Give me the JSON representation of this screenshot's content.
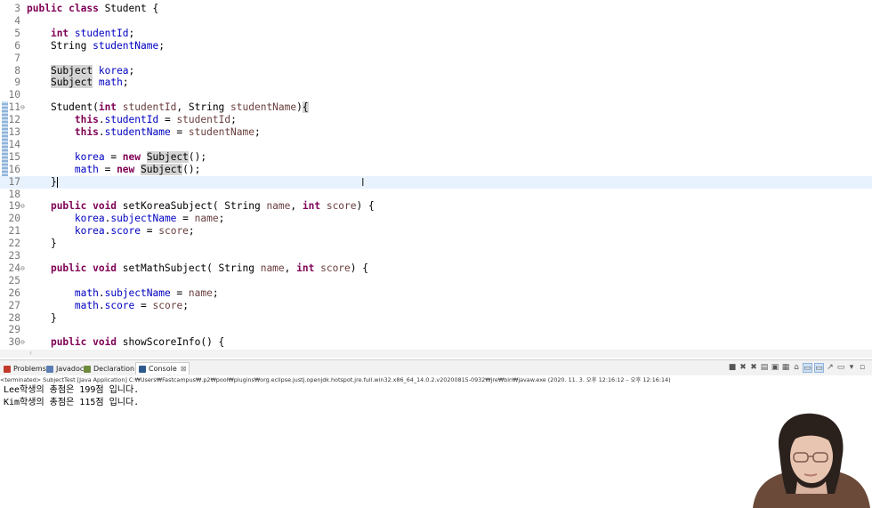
{
  "editor": {
    "lines": [
      {
        "n": "3",
        "segs": [
          {
            "t": "public class ",
            "c": "kw"
          },
          {
            "t": "Student {"
          }
        ]
      },
      {
        "n": "4",
        "segs": []
      },
      {
        "n": "5",
        "segs": [
          {
            "t": "    "
          },
          {
            "t": "int ",
            "c": "kw"
          },
          {
            "t": "studentId",
            "c": "fd"
          },
          {
            "t": ";"
          }
        ]
      },
      {
        "n": "6",
        "segs": [
          {
            "t": "    String "
          },
          {
            "t": "studentName",
            "c": "fd"
          },
          {
            "t": ";"
          }
        ]
      },
      {
        "n": "7",
        "segs": []
      },
      {
        "n": "8",
        "segs": [
          {
            "t": "    "
          },
          {
            "t": "Subject",
            "c": "hl"
          },
          {
            "t": " "
          },
          {
            "t": "korea",
            "c": "fd"
          },
          {
            "t": ";"
          }
        ]
      },
      {
        "n": "9",
        "segs": [
          {
            "t": "    "
          },
          {
            "t": "Subject",
            "c": "hl"
          },
          {
            "t": " "
          },
          {
            "t": "math",
            "c": "fd"
          },
          {
            "t": ";"
          }
        ]
      },
      {
        "n": "10",
        "segs": []
      },
      {
        "n": "11",
        "fold": true,
        "segs": [
          {
            "t": "    Student("
          },
          {
            "t": "int ",
            "c": "kw"
          },
          {
            "t": "studentId",
            "c": "pm"
          },
          {
            "t": ", String "
          },
          {
            "t": "studentName",
            "c": "pm"
          },
          {
            "t": ")"
          },
          {
            "t": "{",
            "c": "hl"
          }
        ]
      },
      {
        "n": "12",
        "segs": [
          {
            "t": "        "
          },
          {
            "t": "this",
            "c": "kw"
          },
          {
            "t": "."
          },
          {
            "t": "studentId",
            "c": "fd"
          },
          {
            "t": " = "
          },
          {
            "t": "studentId",
            "c": "pm"
          },
          {
            "t": ";"
          }
        ]
      },
      {
        "n": "13",
        "segs": [
          {
            "t": "        "
          },
          {
            "t": "this",
            "c": "kw"
          },
          {
            "t": "."
          },
          {
            "t": "studentName",
            "c": "fd"
          },
          {
            "t": " = "
          },
          {
            "t": "studentName",
            "c": "pm"
          },
          {
            "t": ";"
          }
        ]
      },
      {
        "n": "14",
        "segs": []
      },
      {
        "n": "15",
        "segs": [
          {
            "t": "        "
          },
          {
            "t": "korea",
            "c": "fd"
          },
          {
            "t": " = "
          },
          {
            "t": "new ",
            "c": "kw"
          },
          {
            "t": "Subject",
            "c": "hl"
          },
          {
            "t": "();"
          }
        ]
      },
      {
        "n": "16",
        "segs": [
          {
            "t": "        "
          },
          {
            "t": "math",
            "c": "fd"
          },
          {
            "t": " = "
          },
          {
            "t": "new ",
            "c": "kw"
          },
          {
            "t": "Subject",
            "c": "hl"
          },
          {
            "t": "();"
          }
        ]
      },
      {
        "n": "17",
        "current": true,
        "segs": [
          {
            "t": "    }"
          },
          {
            "caret": true
          }
        ]
      },
      {
        "n": "18",
        "segs": []
      },
      {
        "n": "19",
        "fold": true,
        "segs": [
          {
            "t": "    "
          },
          {
            "t": "public void ",
            "c": "kw"
          },
          {
            "t": "setKoreaSubject( String "
          },
          {
            "t": "name",
            "c": "pm"
          },
          {
            "t": ", "
          },
          {
            "t": "int ",
            "c": "kw"
          },
          {
            "t": "score",
            "c": "pm"
          },
          {
            "t": ") {"
          }
        ]
      },
      {
        "n": "20",
        "segs": [
          {
            "t": "        "
          },
          {
            "t": "korea",
            "c": "fd"
          },
          {
            "t": "."
          },
          {
            "t": "subjectName",
            "c": "fd"
          },
          {
            "t": " = "
          },
          {
            "t": "name",
            "c": "pm"
          },
          {
            "t": ";"
          }
        ]
      },
      {
        "n": "21",
        "segs": [
          {
            "t": "        "
          },
          {
            "t": "korea",
            "c": "fd"
          },
          {
            "t": "."
          },
          {
            "t": "score",
            "c": "fd"
          },
          {
            "t": " = "
          },
          {
            "t": "score",
            "c": "pm"
          },
          {
            "t": ";"
          }
        ]
      },
      {
        "n": "22",
        "segs": [
          {
            "t": "    }"
          }
        ]
      },
      {
        "n": "23",
        "segs": []
      },
      {
        "n": "24",
        "fold": true,
        "segs": [
          {
            "t": "    "
          },
          {
            "t": "public void ",
            "c": "kw"
          },
          {
            "t": "setMathSubject( String "
          },
          {
            "t": "name",
            "c": "pm"
          },
          {
            "t": ", "
          },
          {
            "t": "int ",
            "c": "kw"
          },
          {
            "t": "score",
            "c": "pm"
          },
          {
            "t": ") {"
          }
        ]
      },
      {
        "n": "25",
        "segs": []
      },
      {
        "n": "26",
        "segs": [
          {
            "t": "        "
          },
          {
            "t": "math",
            "c": "fd"
          },
          {
            "t": "."
          },
          {
            "t": "subjectName",
            "c": "fd"
          },
          {
            "t": " = "
          },
          {
            "t": "name",
            "c": "pm"
          },
          {
            "t": ";"
          }
        ]
      },
      {
        "n": "27",
        "segs": [
          {
            "t": "        "
          },
          {
            "t": "math",
            "c": "fd"
          },
          {
            "t": "."
          },
          {
            "t": "score",
            "c": "fd"
          },
          {
            "t": " = "
          },
          {
            "t": "score",
            "c": "pm"
          },
          {
            "t": ";"
          }
        ]
      },
      {
        "n": "28",
        "segs": [
          {
            "t": "    }"
          }
        ]
      },
      {
        "n": "29",
        "segs": []
      },
      {
        "n": "30",
        "fold": true,
        "segs": [
          {
            "t": "    "
          },
          {
            "t": "public void ",
            "c": "kw"
          },
          {
            "t": "showScoreInfo() {"
          }
        ]
      }
    ]
  },
  "panel": {
    "tabs": [
      {
        "label": "Problems",
        "icon": "problems-icon",
        "color": "#c0392b"
      },
      {
        "label": "Javadoc",
        "icon": "javadoc-icon",
        "color": "#5b7fb5"
      },
      {
        "label": "Declaration",
        "icon": "declaration-icon",
        "color": "#6c8c3c"
      },
      {
        "label": "Console",
        "icon": "console-icon",
        "color": "#2d5a8c",
        "active": true,
        "close": "⊠"
      }
    ],
    "toolbar": [
      {
        "name": "terminate-icon",
        "g": "■"
      },
      {
        "name": "remove-launch-icon",
        "g": "✖"
      },
      {
        "name": "remove-all-icon",
        "g": "✖"
      },
      {
        "name": "clear-console-icon",
        "g": "▤"
      },
      {
        "name": "scroll-lock-icon",
        "g": "▣"
      },
      {
        "name": "word-wrap-icon",
        "g": "▦"
      },
      {
        "name": "pin-console-icon",
        "g": "⌂"
      },
      {
        "name": "show-on-stdout-icon",
        "g": "▭",
        "sel": true
      },
      {
        "name": "show-on-stderr-icon",
        "g": "▭",
        "sel": true
      },
      {
        "name": "open-console-icon",
        "g": "↗"
      },
      {
        "name": "display-console-icon",
        "g": "▭"
      },
      {
        "name": "minimize-icon",
        "g": "▾"
      },
      {
        "name": "maximize-icon",
        "g": "▫"
      }
    ],
    "terminated": "<terminated> SubjectTest [Java Application] C:₩Users₩Fastcampus₩.p2₩pool₩plugins₩org.eclipse.justj.openjdk.hotspot.jre.full.win32.x86_64_14.0.2.v20200815-0932₩jre₩bin₩javaw.exe  (2020. 11. 3. 오후 12:16:12 – 오후 12:16:14)",
    "output": [
      "Lee학생의 총점은 199점 입니다.",
      "Kim학생의 총점은 115점 입니다."
    ]
  },
  "colors": {
    "keyword": "#7f0055",
    "field": "#0000c0",
    "param": "#6a3e3e",
    "currentLine": "#e8f2fe"
  }
}
